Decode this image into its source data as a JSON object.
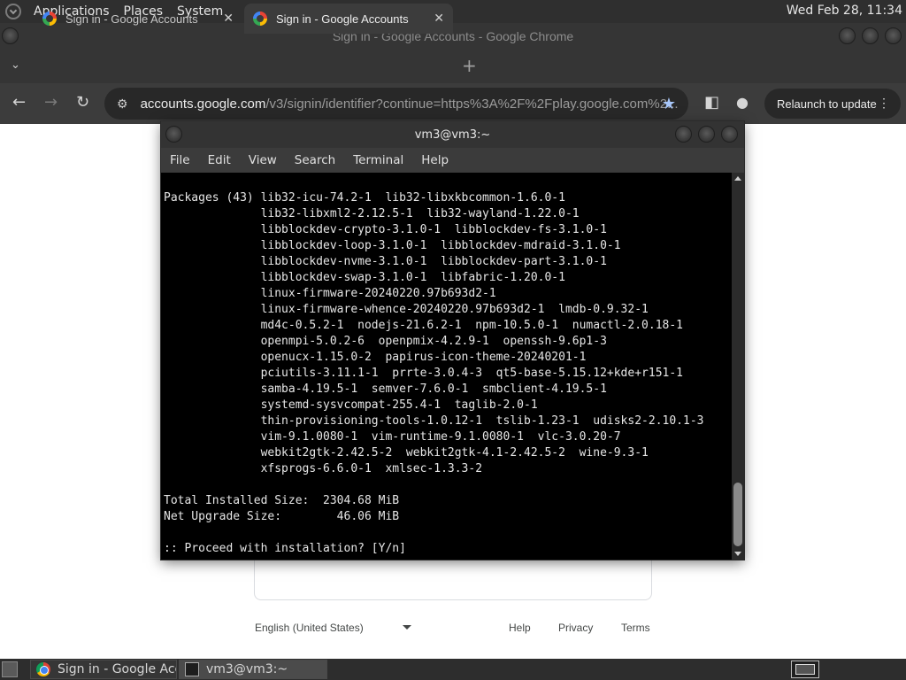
{
  "top_panel": {
    "menus": [
      "Applications",
      "Places",
      "System"
    ],
    "clock": "Wed Feb 28, 11:34"
  },
  "chrome": {
    "window_title": "Sign in - Google Accounts - Google Chrome",
    "tabs": [
      {
        "label": "Sign in - Google Accounts",
        "close": "✕"
      },
      {
        "label": "Sign in - Google Accounts",
        "close": "✕"
      }
    ],
    "new_tab": "+",
    "tab_search": "⌄",
    "url_host": "accounts.google.com",
    "url_path": "/v3/signin/identifier?continue=https%3A%2F%2Fplay.google.com%2...",
    "relaunch_label": "Relaunch to update",
    "icons": {
      "back": "←",
      "forward": "→",
      "reload": "↻",
      "tune": "⚙",
      "star": "★",
      "side_panel": "◧",
      "profile": "●",
      "more": "⋮"
    }
  },
  "page": {
    "language": "English (United States)",
    "footer_links": [
      "Help",
      "Privacy",
      "Terms"
    ]
  },
  "terminal": {
    "title": "vm3@vm3:~",
    "menu": [
      "File",
      "Edit",
      "View",
      "Search",
      "Terminal",
      "Help"
    ],
    "lines": [
      "Packages (43) lib32-icu-74.2-1  lib32-libxkbcommon-1.6.0-1",
      "              lib32-libxml2-2.12.5-1  lib32-wayland-1.22.0-1",
      "              libblockdev-crypto-3.1.0-1  libblockdev-fs-3.1.0-1",
      "              libblockdev-loop-3.1.0-1  libblockdev-mdraid-3.1.0-1",
      "              libblockdev-nvme-3.1.0-1  libblockdev-part-3.1.0-1",
      "              libblockdev-swap-3.1.0-1  libfabric-1.20.0-1",
      "              linux-firmware-20240220.97b693d2-1",
      "              linux-firmware-whence-20240220.97b693d2-1  lmdb-0.9.32-1",
      "              md4c-0.5.2-1  nodejs-21.6.2-1  npm-10.5.0-1  numactl-2.0.18-1",
      "              openmpi-5.0.2-6  openpmix-4.2.9-1  openssh-9.6p1-3",
      "              openucx-1.15.0-2  papirus-icon-theme-20240201-1",
      "              pciutils-3.11.1-1  prrte-3.0.4-3  qt5-base-5.15.12+kde+r151-1",
      "              samba-4.19.5-1  semver-7.6.0-1  smbclient-4.19.5-1",
      "              systemd-sysvcompat-255.4-1  taglib-2.0-1",
      "              thin-provisioning-tools-1.0.12-1  tslib-1.23-1  udisks2-2.10.1-3",
      "              vim-9.1.0080-1  vim-runtime-9.1.0080-1  vlc-3.0.20-7",
      "              webkit2gtk-2.42.5-2  webkit2gtk-4.1-2.42.5-2  wine-9.3-1",
      "              xfsprogs-6.6.0-1  xmlsec-1.3.3-2",
      "",
      "Total Installed Size:  2304.68 MiB",
      "Net Upgrade Size:        46.06 MiB",
      "",
      ":: Proceed with installation? [Y/n]"
    ]
  },
  "taskbar": {
    "tasks": [
      {
        "label": "Sign in - Google Acc..."
      },
      {
        "label": "vm3@vm3:~"
      }
    ]
  }
}
